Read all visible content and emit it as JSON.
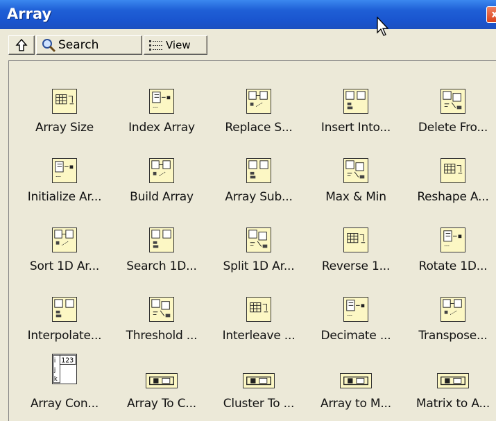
{
  "window": {
    "title": "Array",
    "close_glyph": "x"
  },
  "toolbar": {
    "up_icon": "up-arrow-icon",
    "search_label": "Search",
    "view_label": "View"
  },
  "palette": {
    "rows": [
      [
        {
          "label": "Array Size",
          "icon": "array-size-icon"
        },
        {
          "label": "Index Array",
          "icon": "index-array-icon"
        },
        {
          "label": "Replace S...",
          "icon": "replace-subset-icon"
        },
        {
          "label": "Insert Into...",
          "icon": "insert-into-array-icon"
        },
        {
          "label": "Delete Fro...",
          "icon": "delete-from-array-icon"
        }
      ],
      [
        {
          "label": "Initialize Ar...",
          "icon": "initialize-array-icon"
        },
        {
          "label": "Build Array",
          "icon": "build-array-icon"
        },
        {
          "label": "Array Sub...",
          "icon": "array-subset-icon"
        },
        {
          "label": "Max & Min",
          "icon": "max-min-icon"
        },
        {
          "label": "Reshape A...",
          "icon": "reshape-array-icon"
        }
      ],
      [
        {
          "label": "Sort 1D Ar...",
          "icon": "sort-1d-array-icon"
        },
        {
          "label": "Search 1D...",
          "icon": "search-1d-array-icon"
        },
        {
          "label": "Split 1D Ar...",
          "icon": "split-1d-array-icon"
        },
        {
          "label": "Reverse 1...",
          "icon": "reverse-1d-array-icon"
        },
        {
          "label": "Rotate 1D...",
          "icon": "rotate-1d-array-icon"
        }
      ],
      [
        {
          "label": "Interpolate...",
          "icon": "interpolate-array-icon"
        },
        {
          "label": "Threshold ...",
          "icon": "threshold-array-icon"
        },
        {
          "label": "Interleave ...",
          "icon": "interleave-arrays-icon"
        },
        {
          "label": "Decimate ...",
          "icon": "decimate-array-icon"
        },
        {
          "label": "Transpose...",
          "icon": "transpose-array-icon"
        }
      ],
      [
        {
          "label": "Array Con...",
          "icon": "array-constant-icon",
          "const_text": "123"
        },
        {
          "label": "Array To C...",
          "icon": "array-to-cluster-icon"
        },
        {
          "label": "Cluster To ...",
          "icon": "cluster-to-array-icon"
        },
        {
          "label": "Array to M...",
          "icon": "array-to-matrix-icon"
        },
        {
          "label": "Matrix to A...",
          "icon": "matrix-to-array-icon"
        }
      ]
    ]
  },
  "colors": {
    "titlebar": "#1f5fd6",
    "icon_bg": "#fcf7c4",
    "window_bg": "#ece9d8"
  }
}
